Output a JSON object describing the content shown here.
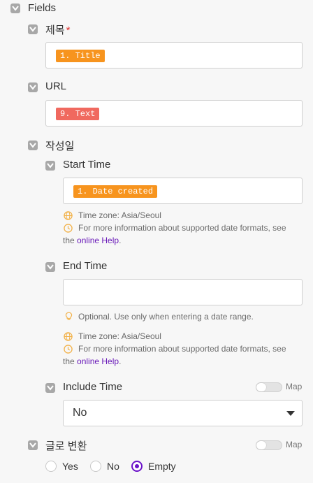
{
  "fields_section": {
    "label": "Fields"
  },
  "title_field": {
    "label": "제목",
    "required_mark": "*",
    "token": "1. Title",
    "token_color": "#f7941e"
  },
  "url_field": {
    "label": "URL",
    "token": "9. Text",
    "token_color": "#f0695f"
  },
  "date_field": {
    "label": "작성일",
    "start_time": {
      "label": "Start Time",
      "token": "1. Date created",
      "token_color": "#f7941e",
      "timezone_hint": "Time zone: Asia/Seoul",
      "info_hint": "For more information about supported date formats, see",
      "info_prefix": "the",
      "help_link": "online Help",
      "info_suffix": "."
    },
    "end_time": {
      "label": "End Time",
      "value": "",
      "optional_hint": "Optional. Use only when entering a date range.",
      "timezone_hint": "Time zone: Asia/Seoul",
      "info_hint": "For more information about supported date formats, see",
      "info_prefix": "the",
      "help_link": "online Help",
      "info_suffix": "."
    },
    "include_time": {
      "label": "Include Time",
      "map_label": "Map",
      "selected": "No"
    }
  },
  "to_text_field": {
    "label": "글로 변환",
    "map_label": "Map",
    "options": [
      "Yes",
      "No",
      "Empty"
    ],
    "selected": "Empty"
  },
  "colors": {
    "accent": "#6b13c9",
    "hint_icon": "#f2b24a",
    "checkbox": "#a8a8a8"
  }
}
